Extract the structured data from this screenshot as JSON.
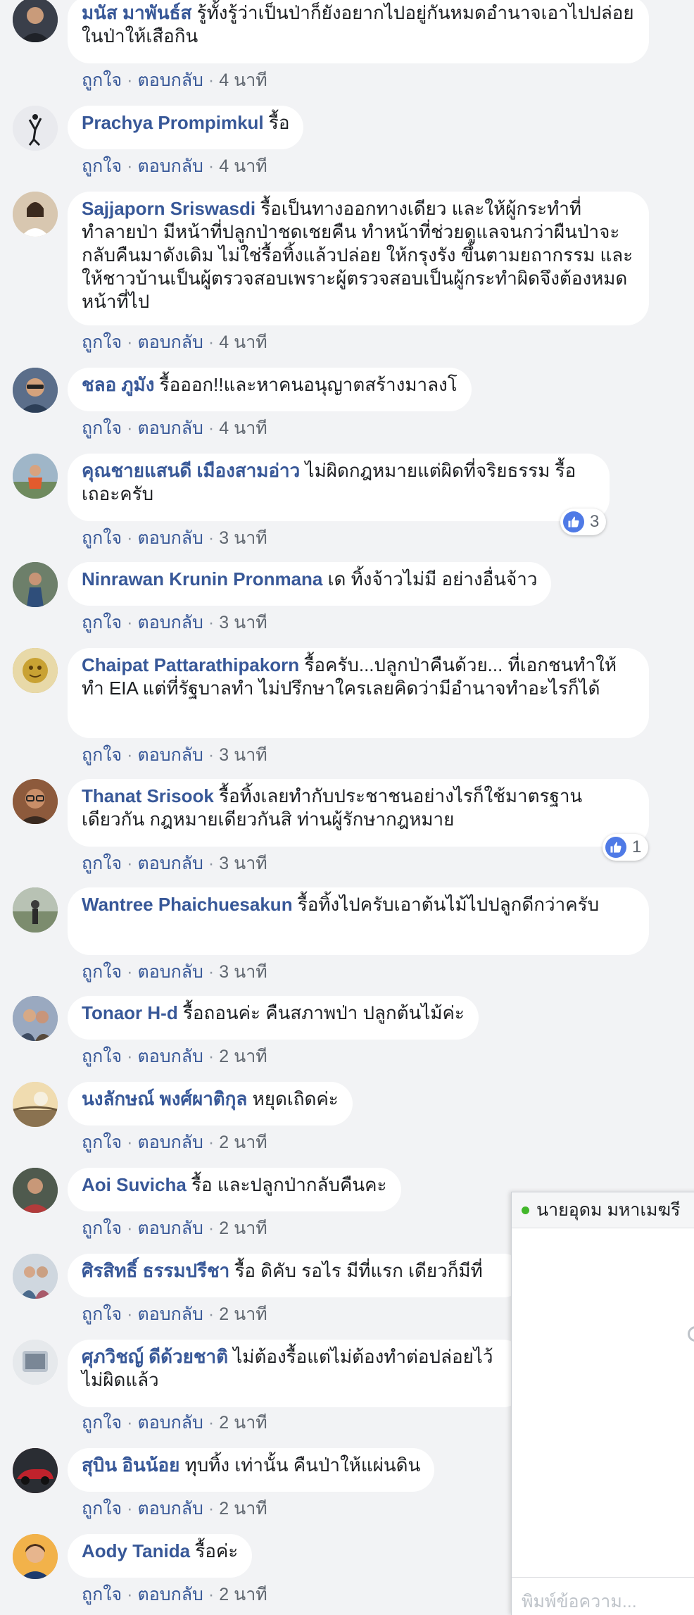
{
  "actions": {
    "like": "ถูกใจ",
    "reply": "ตอบกลับ",
    "separator": "·"
  },
  "comments": [
    {
      "author": "มนัส มาพันธ์ส",
      "text": "รู้ทั้งรู้ว่าเป็นป่าก็ยังอยากไปอยู่กันหมดอำนาจเอาไปปล่อยในป่าให้เสือกิน",
      "time": "4 นาที"
    },
    {
      "author": "Prachya Prompimkul",
      "text": "รื้อ",
      "time": "4 นาที"
    },
    {
      "author": "Sajjaporn Sriswasdi",
      "text": "รื้อเป็นทางออกทางเดียว และให้ผู้กระทำที่ทำลายป่า มีหน้าที่ปลูกป่าชดเชยคืน ทำหน้าที่ช่วยดูแลจนกว่าผืนป่าจะกลับคืนมาดังเดิม ไม่ใช่รื้อทิ้งแล้วปล่อย ให้กรุงรัง ขึ้นตามยถากรรม และให้ชาวบ้านเป็นผู้ตรวจสอบเพราะผู้ตรวจสอบเป็นผู้กระทำผิดจึงต้องหมดหน้าที่ไป",
      "time": "4 นาที"
    },
    {
      "author": "ชลอ ภูมัง",
      "text": "รื้อออก!!และหาคนอนุญาตสร้างมาลงโ",
      "time": "4 นาที"
    },
    {
      "author": "คุณชายแสนดี เมืองสามอ่าว",
      "text": "ไม่ผิดกฎหมายแต่ผิดที่จริยธรรม รื้อเถอะครับ",
      "time": "3 นาที",
      "likes": "3"
    },
    {
      "author": "Ninrawan Krunin Pronmana",
      "text": "เด ทิ้งจ้าวไม่มี อย่างอื่นจ้าว",
      "time": "3 นาที"
    },
    {
      "author": "Chaipat Pattarathipakorn",
      "text": "รื้อครับ...ปลูกป่าคืนด้วย... ที่เอกชนทำให้ทำ EIA แต่ที่รัฐบาลทำ ไม่ปรึกษาใครเลยคิดว่ามีอำนาจทำอะไรก็ได้",
      "time": "3 นาที"
    },
    {
      "author": "Thanat Srisook",
      "text": "รื้อทิ้งเลยทำกับประชาชนอย่างไรก็ใช้มาตรฐานเดียวกัน กฎหมายเดียวกันสิ ท่านผู้รักษากฎหมาย",
      "time": "3 นาที",
      "likes": "1"
    },
    {
      "author": "Wantree Phaichuesakun",
      "text": "รื้อทิ้งไปครับเอาต้นไม้ไปปลูกดีกว่าครับ",
      "time": "3 นาที"
    },
    {
      "author": "Tonaor H-d",
      "text": "รื้อถอนค่ะ คืนสภาพป่า ปลูกต้นไม้ค่ะ",
      "time": "2 นาที"
    },
    {
      "author": "นงลักษณ์ พงศ์ผาติกุล",
      "text": "หยุดเถิดค่ะ",
      "time": "2 นาที"
    },
    {
      "author": "Aoi Suvicha",
      "text": "รื้อ และปลูกป่ากลับคืนคะ",
      "time": "2 นาที"
    },
    {
      "author": "ศิรสิทธิ์ ธรรมปรีชา",
      "text": "รื้อ ดิคับ รอไร มีที่แรก เดียวก็มีที่",
      "time": "2 นาที"
    },
    {
      "author": "ศุภวิชญ์ ดีด้วยชาติ",
      "text": "ไม่ต้องรื้อแต่ไม่ต้องทำต่อปล่อยไว้ ไม่ผิดแล้ว",
      "time": "2 นาที"
    },
    {
      "author": "สุบิน อินน้อย",
      "text": "ทุบทิ้ง เท่านั้น คืนป่าให้แผ่นดิน",
      "time": "2 นาที"
    },
    {
      "author": "Aody Tanida",
      "text": "รื้อค่ะ",
      "time": "2 นาที"
    }
  ],
  "chat": {
    "name": "นายอุดม มหาเมฆรี",
    "placeholder": "พิมพ์ข้อความ...",
    "status": "online"
  },
  "colors": {
    "author": "#385898",
    "like_blue": "#4f7ae6",
    "online_green": "#42b72a",
    "page_background": "#f2f3f5"
  }
}
